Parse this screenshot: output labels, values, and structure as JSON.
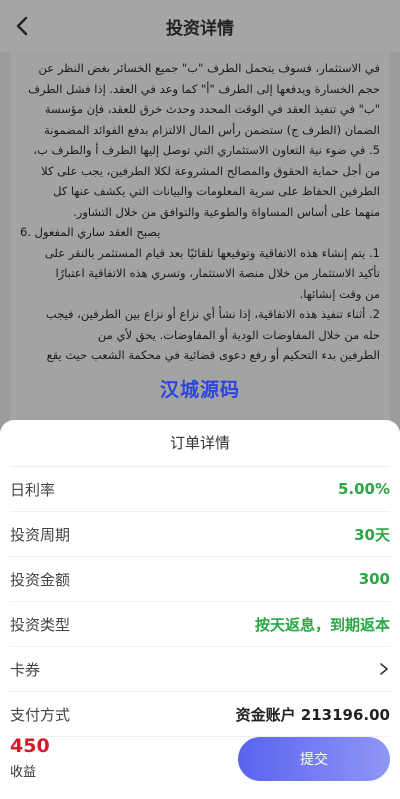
{
  "header": {
    "title": "投资详情",
    "back_icon": "chevron-left-icon"
  },
  "contract": {
    "lines": [
      "في الاستثمار، فسوف يتحمل الطرف \"ب\" جميع الخسائر بغض النظر عن",
      "حجم الخسارة ويدفعها إلى الطرف \"أ\" كما وعد في العقد. إذا فشل الطرف",
      "\"ب\" في تنفيذ العقد في الوقت المحدد وحدث خرق للعقد، فإن مؤسسة",
      "الضمان (الطرف ج) ستضمن رأس المال الالتزام بدفع الفوائد المضمونة",
      "5. في ضوء نية التعاون الاستثماري التي توصل إليها الطرف أ والطرف ب،",
      "من أجل حماية الحقوق والمصالح المشروعة لكلا الطرفين، يجب على كلا",
      "الطرفين الحفاظ على سرية المعلومات والبيانات التي يكشف عنها كل",
      "منهما على أساس المساواة والطوعية والتوافق من خلال التشاور.",
      "6. يصبح العقد ساري المفعول",
      "1. يتم إنشاء هذه الاتفاقية وتوقيعها تلقائيًا بعد قيام المستثمر بالنقر على",
      "تأكيد الاستثمار من خلال منصة الاستثمار، وتسري هذه الاتفاقية اعتبارًا",
      "من وقت إنشائها.",
      "2. أثناء تنفيذ هذه الاتفاقية، إذا نشأ أي نزاع أو نزاع بين الطرفين، فيجب",
      "حله من خلال المفاوضات الودية أو المفاوضات. يحق لأي من",
      "الطرفين بدء التحكيم أو رفع دعوى قضائية في محكمة الشعب حيث يقع"
    ]
  },
  "watermark": "汉城源码",
  "order": {
    "title": "订单详情",
    "rows": [
      {
        "label": "日利率",
        "value": "5.00%"
      },
      {
        "label": "投资周期",
        "value": "30天"
      },
      {
        "label": "投资金额",
        "value": "300"
      },
      {
        "label": "投资类型",
        "value": "按天返息，到期返本"
      },
      {
        "label": "卡券",
        "value": ""
      },
      {
        "label": "支付方式",
        "value": "资金账户 213196.00"
      }
    ],
    "card_chevron_icon": "chevron-right-icon"
  },
  "footer": {
    "income_amount": "450",
    "income_label": "收益",
    "submit_label": "提交"
  },
  "colors": {
    "accent_green": "#28a745",
    "income_red": "#d51a2a",
    "button_blue": "#5a63ee"
  }
}
